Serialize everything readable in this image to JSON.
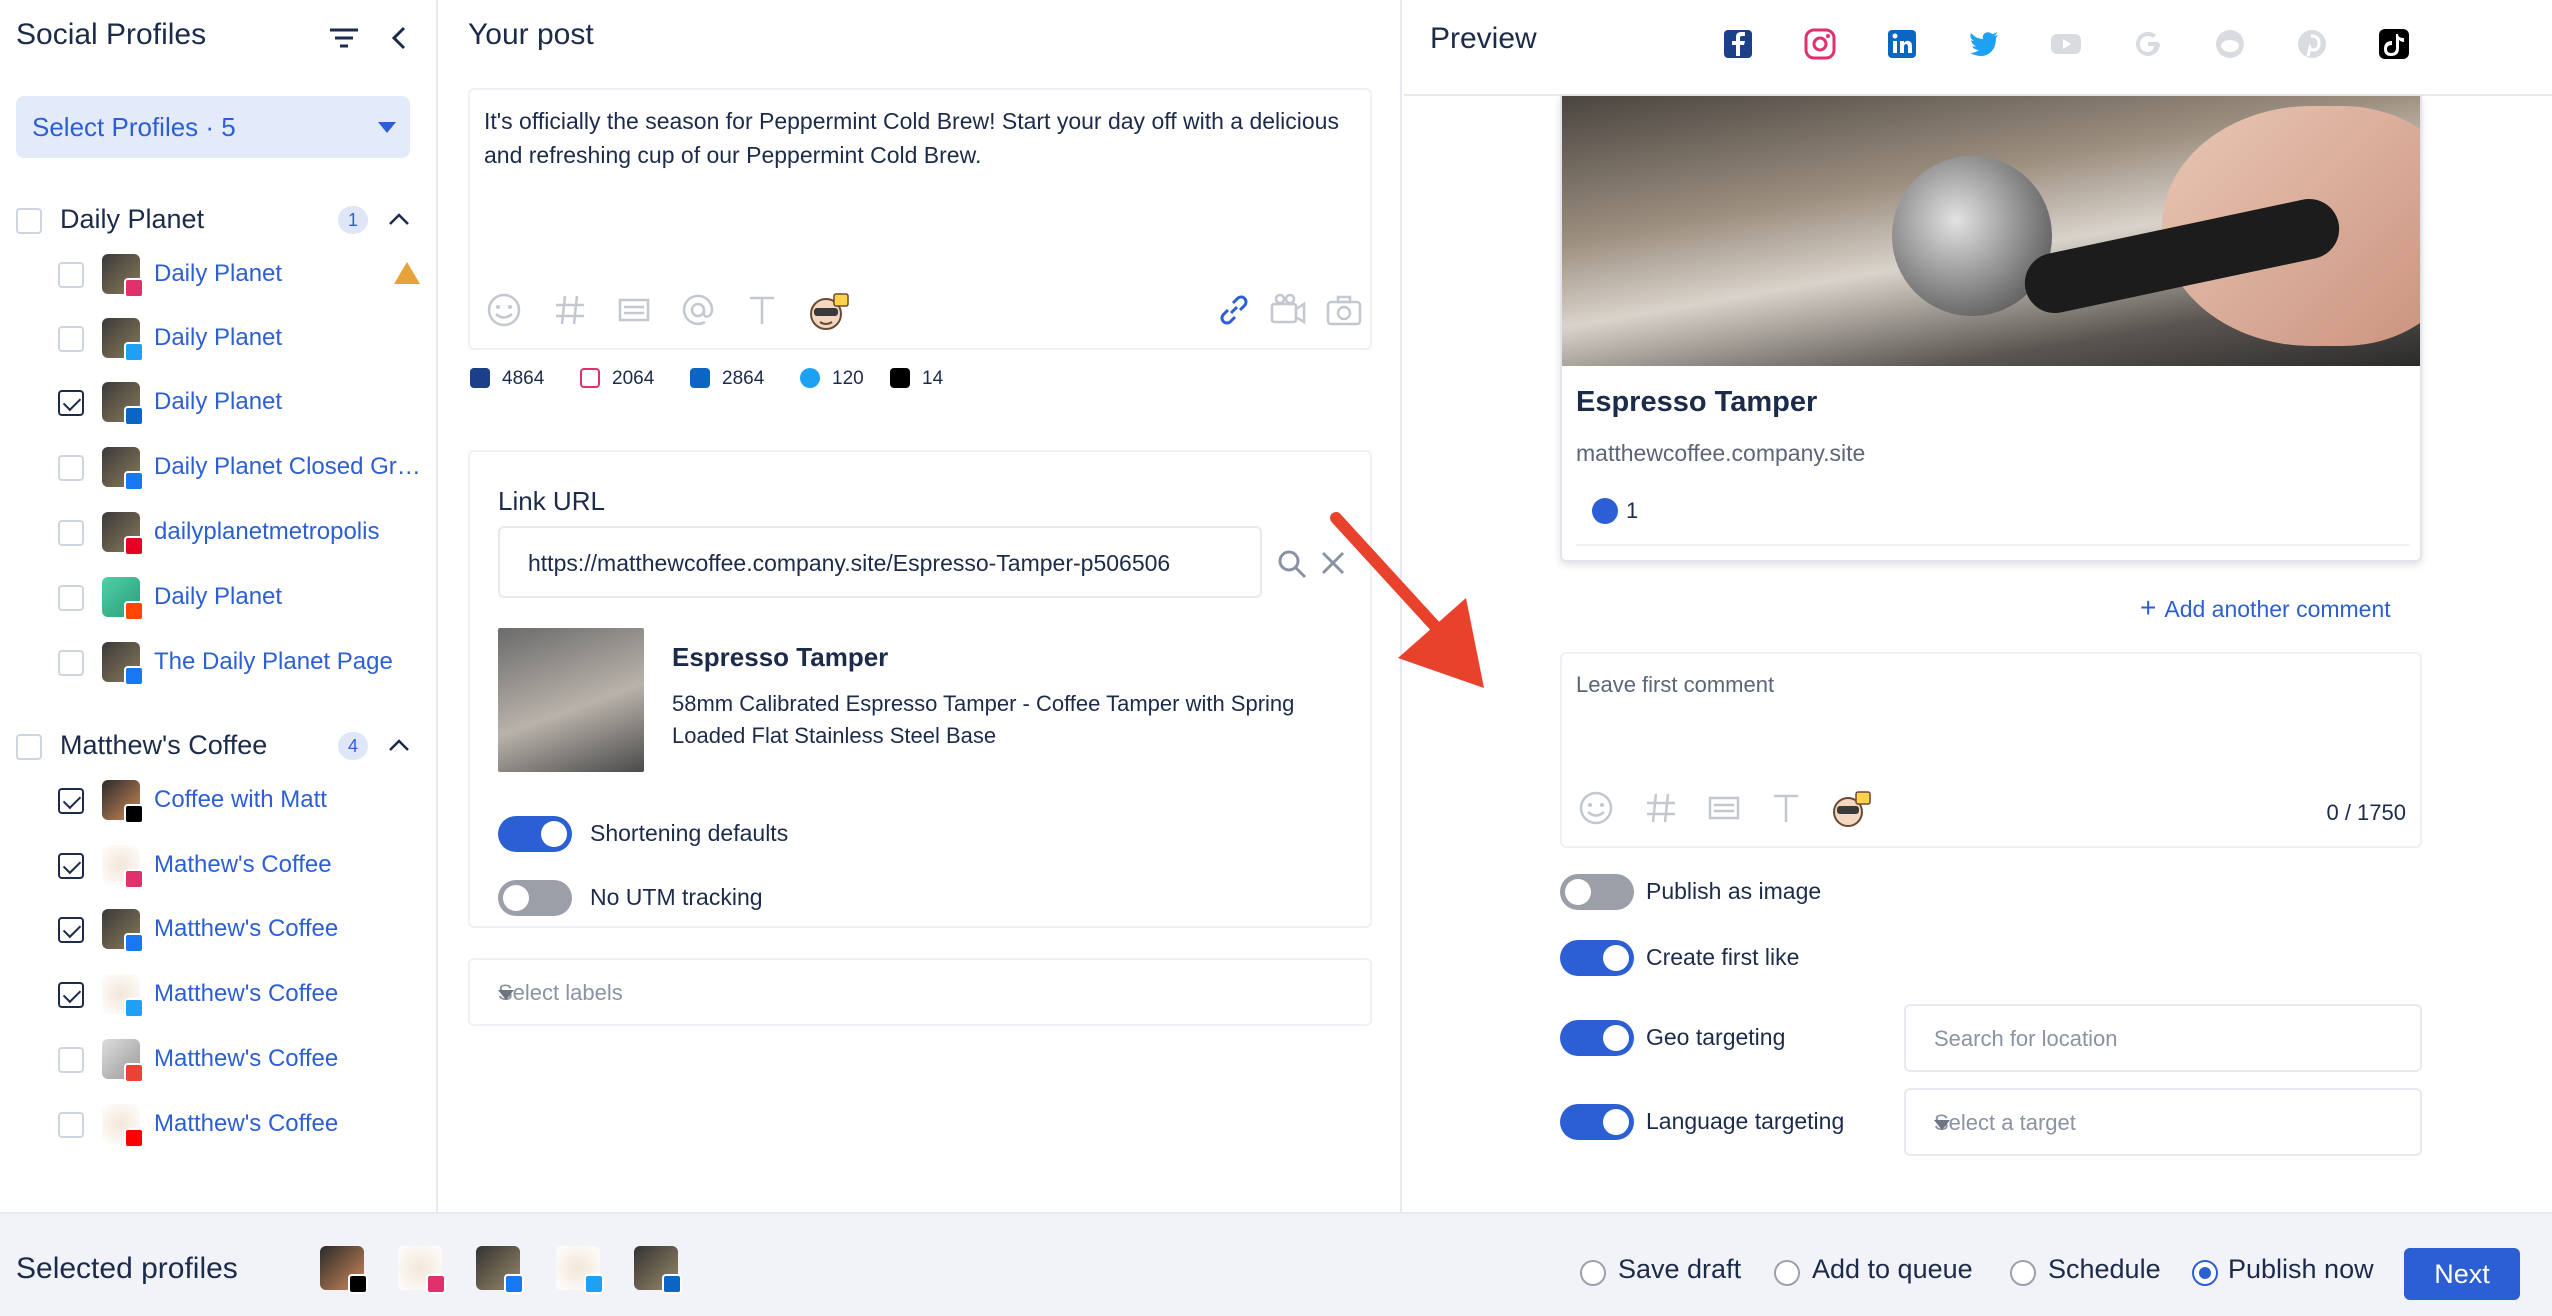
{
  "sidebar": {
    "title": "Social Profiles",
    "select_profiles": "Select Profiles · 5",
    "groups": [
      {
        "name": "Daily Planet",
        "count": "1",
        "profiles": [
          {
            "name": "Daily Planet",
            "network": "instagram",
            "checked": false,
            "warning": true
          },
          {
            "name": "Daily Planet",
            "network": "twitter",
            "checked": false
          },
          {
            "name": "Daily Planet",
            "network": "linkedin",
            "checked": true
          },
          {
            "name": "Daily Planet Closed Gro...",
            "network": "facebook",
            "checked": false
          },
          {
            "name": "dailyplanetmetropolis",
            "network": "pinterest",
            "checked": false
          },
          {
            "name": "Daily Planet",
            "network": "reddit",
            "checked": false
          },
          {
            "name": "The Daily Planet Page",
            "network": "facebook",
            "checked": false
          }
        ]
      },
      {
        "name": "Matthew's Coffee",
        "count": "4",
        "profiles": [
          {
            "name": "Coffee with Matt",
            "network": "tiktok",
            "checked": true
          },
          {
            "name": "Mathew's Coffee",
            "network": "instagram",
            "checked": true
          },
          {
            "name": "Matthew's Coffee",
            "network": "facebook",
            "checked": true
          },
          {
            "name": "Matthew's Coffee",
            "network": "twitter",
            "checked": true
          },
          {
            "name": "Matthew's Coffee",
            "network": "google",
            "checked": false
          },
          {
            "name": "Matthew's Coffee",
            "network": "youtube",
            "checked": false
          }
        ]
      }
    ]
  },
  "post": {
    "title": "Your post",
    "text": "It's officially the season for Peppermint Cold Brew! Start your day off with a delicious and refreshing cup of our Peppermint Cold Brew.",
    "counts": [
      {
        "network": "facebook",
        "value": "4864"
      },
      {
        "network": "instagram",
        "value": "2064"
      },
      {
        "network": "linkedin",
        "value": "2864"
      },
      {
        "network": "twitter",
        "value": "120"
      },
      {
        "network": "tiktok",
        "value": "14"
      }
    ],
    "link": {
      "label": "Link URL",
      "url": "https://matthewcoffee.company.site/Espresso-Tamper-p506506",
      "title": "Espresso Tamper",
      "description": "58mm Calibrated Espresso Tamper - Coffee Tamper with Spring Loaded Flat Stainless Steel Base",
      "shortening_label": "Shortening defaults",
      "shortening_on": true,
      "utm_label": "No UTM tracking",
      "utm_on": false
    },
    "labels_placeholder": "Select labels"
  },
  "preview": {
    "title": "Preview",
    "active_tab": "linkedin",
    "tabs": [
      "facebook",
      "instagram",
      "linkedin",
      "twitter",
      "youtube",
      "google",
      "reddit",
      "pinterest",
      "tiktok"
    ],
    "card_title": "Espresso Tamper",
    "card_domain": "matthewcoffee.company.site",
    "likes": "1",
    "add_comment": "Add another comment",
    "comment_placeholder": "Leave first comment",
    "comment_length": "0 / 1750",
    "options": {
      "publish_image": {
        "label": "Publish as image",
        "on": false
      },
      "first_like": {
        "label": "Create first like",
        "on": true
      },
      "geo": {
        "label": "Geo targeting",
        "on": true,
        "placeholder": "Search for location"
      },
      "language": {
        "label": "Language targeting",
        "on": true,
        "placeholder": "Select a target"
      }
    }
  },
  "footer": {
    "title": "Selected profiles",
    "avatars": [
      "tiktok",
      "instagram",
      "facebook",
      "twitter",
      "linkedin"
    ],
    "options": [
      {
        "label": "Save draft",
        "selected": false
      },
      {
        "label": "Add to queue",
        "selected": false
      },
      {
        "label": "Schedule",
        "selected": false
      },
      {
        "label": "Publish now",
        "selected": true
      }
    ],
    "next": "Next"
  },
  "colors": {
    "accent": "#2d5fd4",
    "arrow": "#e8412c",
    "facebook": "#1877f2",
    "instagram": "#e1306c",
    "linkedin": "#0a66c2",
    "twitter": "#1da1f2",
    "tiktok": "#000000"
  }
}
